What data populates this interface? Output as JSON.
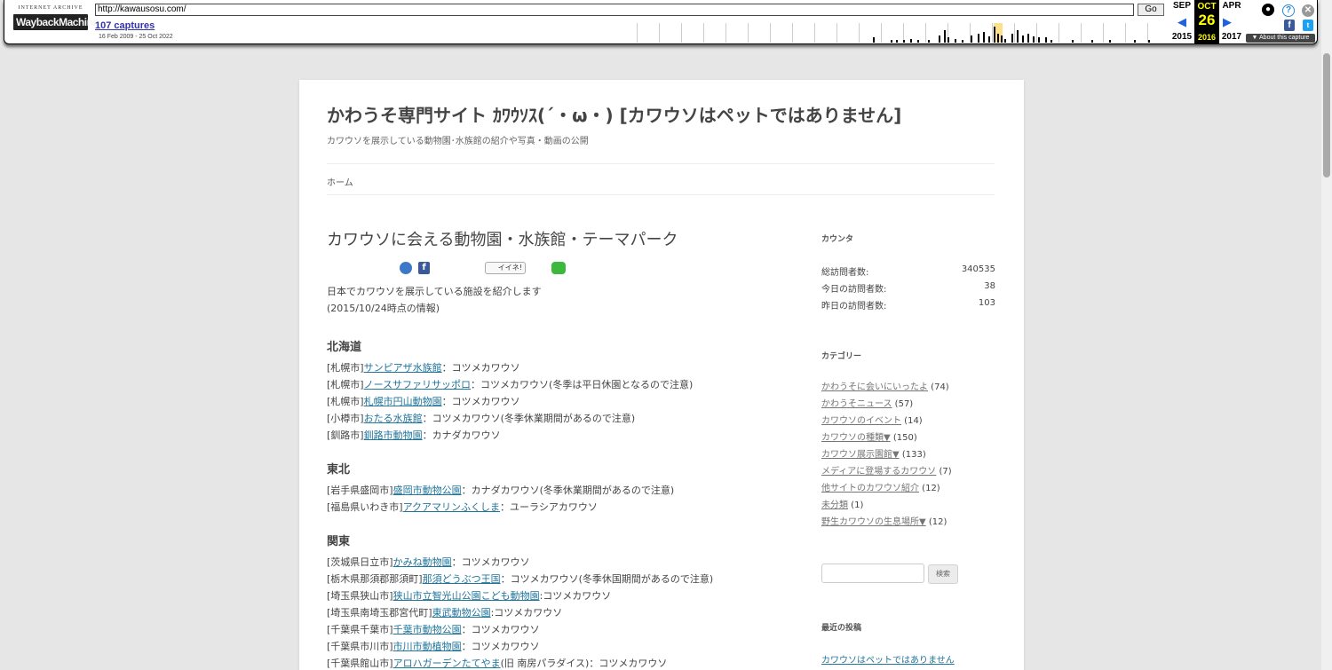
{
  "wayback": {
    "logo_top": "INTERNET ARCHIVE",
    "logo_main": "WaybackMachine",
    "url": "http://kawausosu.com/",
    "go": "Go",
    "captures": "107 captures",
    "range": "16 Feb 2009 - 25 Oct 2022",
    "prev_month": "SEP",
    "prev_year": "2015",
    "cur_month": "OCT",
    "cur_day": "26",
    "cur_year": "2016",
    "next_month": "APR",
    "next_year": "2017",
    "about": "▼ About this capture"
  },
  "site": {
    "title": "かわうそ専門サイト ｶﾜｳｿｽ(´・ω・) [カワウソはペットではありません]",
    "description": "カワウソを展示している動物園･水族館の紹介や写真・動画の公開",
    "nav_home": "ホーム"
  },
  "entry": {
    "title": "カワウソに会える動物園・水族館・テーマパーク",
    "share_iine": "イイネ!",
    "intro1": "日本でカワウソを展示している施設を紹介します",
    "intro2": "(2015/10/24時点の情報)",
    "regions": [
      {
        "name": "北海道",
        "rows": [
          {
            "pre": "[札幌市]",
            "link": "サンピアザ水族館",
            "post": "：コツメカワウソ"
          },
          {
            "pre": "[札幌市]",
            "link": "ノースサファリサッポロ",
            "post": "：コツメカワウソ(冬季は平日休園となるので注意)"
          },
          {
            "pre": "[札幌市]",
            "link": "札幌市円山動物園",
            "post": "：コツメカワウソ"
          },
          {
            "pre": "[小樽市]",
            "link": "おたる水族館",
            "post": "：コツメカワウソ(冬季休業期間があるので注意)"
          },
          {
            "pre": "[釧路市]",
            "link": "釧路市動物園",
            "post": "：カナダカワウソ"
          }
        ]
      },
      {
        "name": "東北",
        "rows": [
          {
            "pre": "[岩手県盛岡市]",
            "link": "盛岡市動物公園",
            "post": "：カナダカワウソ(冬季休業期間があるので注意)"
          },
          {
            "pre": "[福島県いわき市]",
            "link": "アクアマリンふくしま",
            "post": "：ユーラシアカワウソ"
          }
        ]
      },
      {
        "name": "関東",
        "rows": [
          {
            "pre": "[茨城県日立市]",
            "link": "かみね動物園",
            "post": "：コツメカワウソ"
          },
          {
            "pre": "[栃木県那須郡那須町]",
            "link": "那須どうぶつ王国",
            "post": "：コツメカワウソ(冬季休国期間があるので注意)"
          },
          {
            "pre": "[埼玉県狭山市]",
            "link": "狭山市立智光山公園こども動物園",
            "post": ":コツメカワウソ"
          },
          {
            "pre": "[埼玉県南埼玉郡宮代町]",
            "link": "東武動物公園",
            "post": ":コツメカワウソ"
          },
          {
            "pre": "[千葉県千葉市]",
            "link": "千葉市動物公園",
            "post": "：コツメカワウソ"
          },
          {
            "pre": "[千葉県市川市]",
            "link": "市川市動植物園",
            "post": "：コツメカワウソ"
          },
          {
            "pre": "[千葉県館山市]",
            "link": "アロハガーデンたてやま",
            "post": "(旧 南房パラダイス)：コツメカワウソ"
          }
        ]
      }
    ]
  },
  "sidebar": {
    "counter_title": "カウンタ",
    "counters": [
      {
        "label": "総訪問者数:",
        "value": "340535"
      },
      {
        "label": "今日の訪問者数:",
        "value": "38"
      },
      {
        "label": "昨日の訪問者数:",
        "value": "103"
      }
    ],
    "category_title": "カテゴリー",
    "categories": [
      {
        "label": "かわうそに会いにいったよ",
        "count": " (74)"
      },
      {
        "label": "かわうそニュース",
        "count": " (57)"
      },
      {
        "label": "カワウソのイベント",
        "count": " (14)"
      },
      {
        "label": "カワウソの種類▼",
        "count": " (150)"
      },
      {
        "label": "カワウソ展示園館▼",
        "count": " (133)"
      },
      {
        "label": "メディアに登場するカワウソ",
        "count": " (7)"
      },
      {
        "label": "他サイトのカワウソ紹介",
        "count": " (12)"
      },
      {
        "label": "未分類",
        "count": " (1)"
      },
      {
        "label": "野生カワウソの生息場所▼",
        "count": " (12)"
      }
    ],
    "search_button": "検索",
    "recent_title": "最近の投稿",
    "recent": [
      "カワウソはペットではありません"
    ]
  },
  "colors": {
    "link": "#21759b",
    "sidebar_link": "#757575",
    "wayback_current": "#ffff00"
  }
}
